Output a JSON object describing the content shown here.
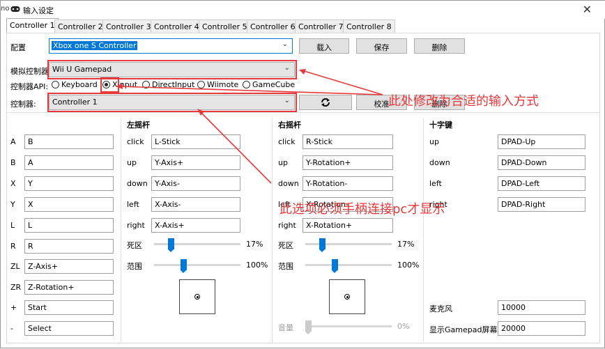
{
  "window": {
    "title": "输入设定",
    "edge_text": "no"
  },
  "tabs": [
    "Controller 1",
    "Controller 2",
    "Controller 3",
    "Controller 4",
    "Controller 5",
    "Controller 6",
    "Controller 7",
    "Controller 8"
  ],
  "config": {
    "label": "配置",
    "value": "Xbox one S Controller",
    "load": "载入",
    "save": "保存",
    "delete": "删除"
  },
  "emulated": {
    "label": "模拟控制器",
    "value": "Wii U Gamepad"
  },
  "api": {
    "label": "控制器API:",
    "options": [
      "Keyboard",
      "XInput",
      "DirectInput",
      "Wiimote",
      "GameCube"
    ],
    "selected": "XInput"
  },
  "controller": {
    "label": "控制器:",
    "value": "Controller 1",
    "calibrate": "校准",
    "delete": "删除"
  },
  "buttons": [
    {
      "key": "A",
      "value": "B"
    },
    {
      "key": "B",
      "value": "A"
    },
    {
      "key": "X",
      "value": "Y"
    },
    {
      "key": "Y",
      "value": "X"
    },
    {
      "key": "L",
      "value": "L"
    },
    {
      "key": "R",
      "value": "R"
    },
    {
      "key": "ZL",
      "value": "Z-Axis+"
    },
    {
      "key": "ZR",
      "value": "Z-Rotation+"
    },
    {
      "key": "+",
      "value": "Start"
    },
    {
      "key": "-",
      "value": "Select"
    }
  ],
  "left_stick": {
    "title": "左摇杆",
    "rows": [
      {
        "key": "click",
        "value": "L-Stick"
      },
      {
        "key": "up",
        "value": "Y-Axis+"
      },
      {
        "key": "down",
        "value": "Y-Axis-"
      },
      {
        "key": "left",
        "value": "X-Axis-"
      },
      {
        "key": "right",
        "value": "X-Axis+"
      }
    ],
    "deadzone_label": "死区",
    "deadzone": 17,
    "deadzone_text": "17%",
    "range_label": "范围",
    "range": 100,
    "range_text": "100%"
  },
  "right_stick": {
    "title": "右摇杆",
    "rows": [
      {
        "key": "click",
        "value": "R-Stick"
      },
      {
        "key": "up",
        "value": "Y-Rotation+"
      },
      {
        "key": "down",
        "value": "Y-Rotation-"
      },
      {
        "key": "left",
        "value": "X-Rotation-"
      },
      {
        "key": "right",
        "value": "X-Rotation+"
      }
    ],
    "deadzone_label": "死区",
    "deadzone": 17,
    "deadzone_text": "17%",
    "range_label": "范围",
    "range": 100,
    "range_text": "100%",
    "volume_label": "音量",
    "volume": 0,
    "volume_text": "0%"
  },
  "dpad": {
    "title": "十字键",
    "rows": [
      {
        "key": "up",
        "value": "DPAD-Up"
      },
      {
        "key": "down",
        "value": "DPAD-Down"
      },
      {
        "key": "left",
        "value": "DPAD-Left"
      },
      {
        "key": "right",
        "value": "DPAD-Right"
      }
    ],
    "mic_label": "麦克风",
    "mic_value": "10000",
    "screen_label": "显示Gamepad屏幕",
    "screen_value": "20000"
  },
  "annotations": {
    "text1": "此处修改为合适的输入方式",
    "text2": "此选项必须手柄连接pc才显示",
    "color": "#e8393a"
  }
}
